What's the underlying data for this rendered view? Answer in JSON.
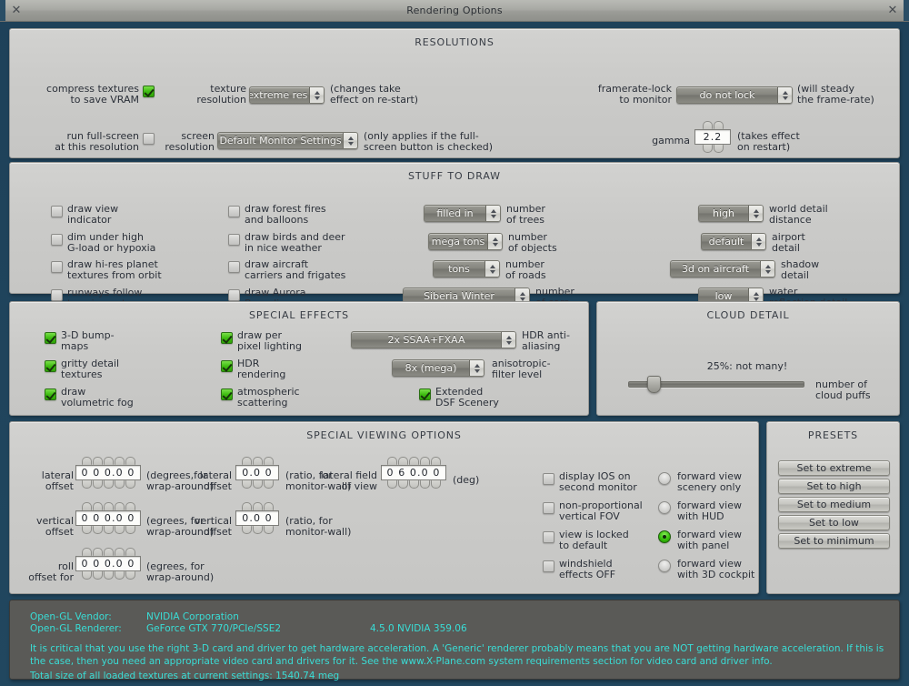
{
  "window": {
    "title": "Rendering Options",
    "close_icon_left": "close-icon",
    "close_icon_right": "close-icon"
  },
  "resolutions": {
    "title": "RESOLUTIONS",
    "compress_textures_label": "compress textures\nto save VRAM",
    "compress_textures_checked": true,
    "texture_resolution_label": "texture\nresolution",
    "texture_resolution_value": "extreme res!",
    "texture_resolution_note": "(changes take\neffect on re-start)",
    "framerate_lock_label": "framerate-lock\nto monitor",
    "framerate_lock_value": "do not lock",
    "framerate_lock_note": "(will steady\nthe frame-rate)",
    "full_screen_label": "run full-screen\nat this resolution",
    "full_screen_checked": false,
    "screen_resolution_label": "screen\nresolution",
    "screen_resolution_value": "Default Monitor Settings",
    "screen_resolution_note": "(only applies if the full-\nscreen button is checked)",
    "gamma_label": "gamma",
    "gamma_value": "2.2",
    "gamma_note": "(takes effect\non restart)"
  },
  "stuff_to_draw": {
    "title": "STUFF TO DRAW",
    "checks_col1": [
      {
        "label": "draw view\nindicator",
        "checked": false
      },
      {
        "label": "dim under high\nG-load or hypoxia",
        "checked": false
      },
      {
        "label": "draw hi-res planet\ntextures from orbit",
        "checked": false
      },
      {
        "label": "runways follow\nterrain contours",
        "checked": false
      }
    ],
    "checks_col2": [
      {
        "label": "draw forest fires\nand balloons",
        "checked": false
      },
      {
        "label": "draw birds and deer\nin nice weather",
        "checked": false
      },
      {
        "label": "draw aircraft\ncarriers and frigates",
        "checked": false
      },
      {
        "label": "draw Aurora\nBorealis",
        "checked": false
      }
    ],
    "dropdowns_col3": [
      {
        "value": "filled in",
        "label": "number\nof trees"
      },
      {
        "value": "mega tons",
        "label": "number\nof objects"
      },
      {
        "value": "tons",
        "label": "number\nof roads"
      },
      {
        "value": "Siberia Winter",
        "label": "number\nof cars"
      }
    ],
    "dropdowns_col4": [
      {
        "value": "high",
        "label": "world detail\ndistance"
      },
      {
        "value": "default",
        "label": "airport\ndetail"
      },
      {
        "value": "3d on aircraft",
        "label": "shadow\ndetail"
      },
      {
        "value": "low",
        "label": "water\nreflection detail"
      }
    ]
  },
  "special_effects": {
    "title": "SPECIAL EFFECTS",
    "checks_col1": [
      {
        "label": "3-D bump-\nmaps",
        "checked": true
      },
      {
        "label": "gritty detail\ntextures",
        "checked": true
      },
      {
        "label": "draw\nvolumetric fog",
        "checked": true
      }
    ],
    "checks_col2": [
      {
        "label": "draw per\npixel lighting",
        "checked": true
      },
      {
        "label": "HDR\nrendering",
        "checked": true
      },
      {
        "label": "atmospheric\nscattering",
        "checked": true
      }
    ],
    "hdr_aa_value": "2x SSAA+FXAA",
    "hdr_aa_label": "HDR anti-\naliasing",
    "aniso_value": "8x (mega)",
    "aniso_label": "anisotropic-\nfilter level",
    "extended_dsf_label": "Extended\nDSF Scenery",
    "extended_dsf_checked": true
  },
  "cloud_detail": {
    "title": "CLOUD DETAIL",
    "slider_value_text": "25%: not many!",
    "slider_percent": 25,
    "slider_label": "number of\ncloud puffs"
  },
  "special_viewing": {
    "title": "SPECIAL VIEWING OPTIONS",
    "steppers": [
      {
        "label": "lateral\noffset",
        "value": "0 0 0.0 0",
        "digits": 5,
        "note": "(degrees,for\nwrap-around)"
      },
      {
        "label": "vertical\noffset",
        "value": "0 0 0.0 0",
        "digits": 5,
        "note": "(egrees, for\nwrap-around)"
      },
      {
        "label": "roll\noffset for",
        "value": "0 0 0.0 0",
        "digits": 5,
        "note": "(egrees, for\nwrap-around)"
      },
      {
        "label": "lateral\noffset",
        "value": "0.0 0",
        "digits": 3,
        "note": "(ratio, for\nmonitor-wall)"
      },
      {
        "label": "vertical\noffset",
        "value": "0.0 0",
        "digits": 3,
        "note": "(ratio, for\nmonitor-wall)"
      },
      {
        "label": "lateral field\nof view",
        "value": "0 6 0.0 0",
        "digits": 5,
        "note": "(deg)"
      }
    ],
    "checks": [
      {
        "label": "display IOS on\nsecond monitor",
        "checked": false
      },
      {
        "label": "non-proportional\nvertical FOV",
        "checked": false
      },
      {
        "label": "view is locked\nto default",
        "checked": false
      },
      {
        "label": "windshield\neffects OFF",
        "checked": false
      }
    ],
    "radios": [
      {
        "label": "forward view\nscenery only",
        "selected": false
      },
      {
        "label": "forward view\nwith HUD",
        "selected": false
      },
      {
        "label": "forward view\nwith panel",
        "selected": true
      },
      {
        "label": "forward view\nwith 3D cockpit",
        "selected": false
      }
    ]
  },
  "presets": {
    "title": "PRESETS",
    "buttons": [
      "Set to extreme",
      "Set to high",
      "Set to medium",
      "Set to low",
      "Set to minimum"
    ]
  },
  "info": {
    "vendor_label": "Open-GL Vendor:",
    "vendor_value": "NVIDIA Corporation",
    "renderer_label": "Open-GL Renderer:",
    "renderer_value": "GeForce GTX 770/PCIe/SSE2",
    "gl_version": "4.5.0 NVIDIA 359.06",
    "warning": "It is critical that you use the right 3-D card and driver to get hardware acceleration. A 'Generic' renderer probably means that you are NOT getting hardware acceleration. If this is the case, then you need an appropriate video card and drivers for it. See the www.X-Plane.com system requirements section for video card and driver info.",
    "texture_total": "Total size of all loaded textures at current settings: 1540.74 meg",
    "text_color": "#39ddd6"
  },
  "colors": {
    "window_bg": "#21475f",
    "panel_bg": "#cbcbc9",
    "accent_green": "#35bd09",
    "dropdown_bg": "#85857e"
  }
}
